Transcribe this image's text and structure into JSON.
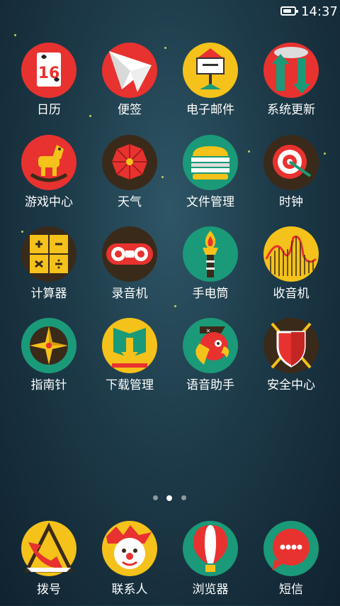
{
  "status_bar": {
    "time": "14:37",
    "battery_level": 0.8
  },
  "colors": {
    "red": "#e8322f",
    "yellow": "#f4c21a",
    "teal": "#1a9a78",
    "dark": "#3a2a1a"
  },
  "apps": [
    {
      "label": "日历",
      "icon": "calendar-icon"
    },
    {
      "label": "便签",
      "icon": "paper-plane-icon"
    },
    {
      "label": "电子邮件",
      "icon": "mailbox-icon"
    },
    {
      "label": "系统更新",
      "icon": "update-arrows-icon"
    },
    {
      "label": "游戏中心",
      "icon": "rocking-horse-icon"
    },
    {
      "label": "天气",
      "icon": "umbrella-icon"
    },
    {
      "label": "文件管理",
      "icon": "folder-stack-icon"
    },
    {
      "label": "时钟",
      "icon": "target-clock-icon"
    },
    {
      "label": "计算器",
      "icon": "puzzle-icon"
    },
    {
      "label": "录音机",
      "icon": "tape-icon"
    },
    {
      "label": "手电筒",
      "icon": "torch-icon"
    },
    {
      "label": "收音机",
      "icon": "rollercoaster-icon"
    },
    {
      "label": "指南针",
      "icon": "compass-icon"
    },
    {
      "label": "下载管理",
      "icon": "download-book-icon"
    },
    {
      "label": "语音助手",
      "icon": "parrot-icon"
    },
    {
      "label": "安全中心",
      "icon": "shield-icon"
    }
  ],
  "pager": {
    "pages": 3,
    "current": 2
  },
  "dock": [
    {
      "label": "拨号",
      "icon": "phone-icon"
    },
    {
      "label": "联系人",
      "icon": "clown-icon"
    },
    {
      "label": "浏览器",
      "icon": "balloon-icon"
    },
    {
      "label": "短信",
      "icon": "message-bubble-icon"
    }
  ],
  "calendar_day": "16"
}
